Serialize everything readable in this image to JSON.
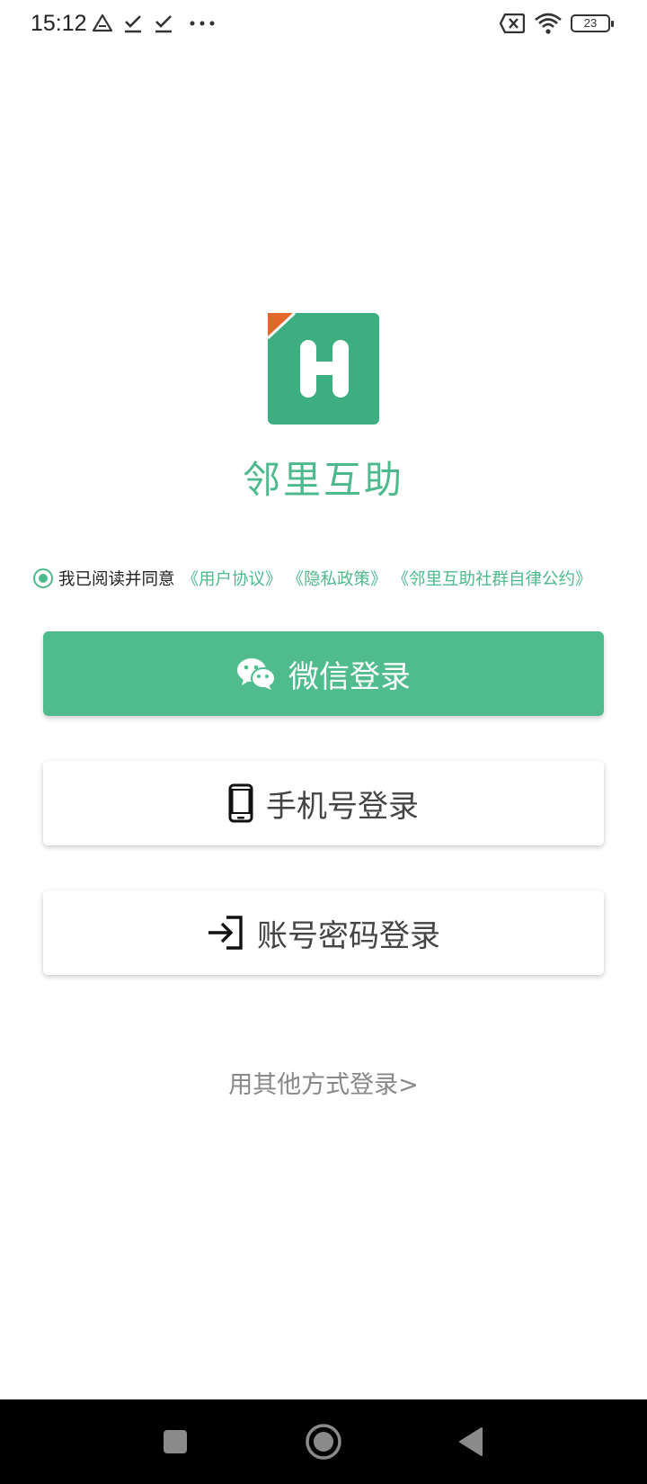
{
  "status_bar": {
    "time": "15:12",
    "battery": "23",
    "icons": [
      "drive-icon",
      "check-download-icon",
      "check-download-icon",
      "more-dots-icon",
      "sim-off-icon",
      "wifi-icon",
      "battery-icon"
    ]
  },
  "app": {
    "name": "邻里互助",
    "logo_letter": "H",
    "brand_color": "#50bc8e",
    "logo_accent_color": "#e2682a"
  },
  "agreement": {
    "prefix": "我已阅读并同意",
    "links": [
      "《用户协议》",
      "《隐私政策》",
      "《邻里互助社群自律公约》"
    ],
    "checked": true
  },
  "buttons": {
    "wechat": "微信登录",
    "phone": "手机号登录",
    "account": "账号密码登录"
  },
  "other_login": "用其他方式登录>",
  "nav": {
    "icons": [
      "recents-square-icon",
      "home-circle-icon",
      "back-triangle-icon"
    ]
  }
}
